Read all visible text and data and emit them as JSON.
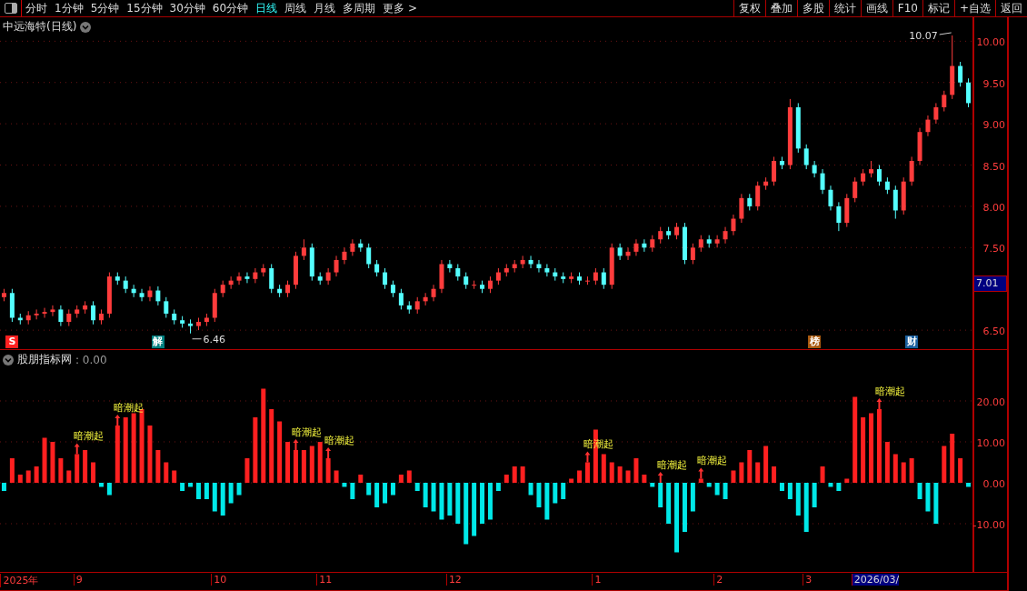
{
  "toolbar": {
    "tabs": [
      {
        "label": "分时",
        "selected": false
      },
      {
        "label": "1分钟",
        "selected": false
      },
      {
        "label": "5分钟",
        "selected": false
      },
      {
        "label": "15分钟",
        "selected": false
      },
      {
        "label": "30分钟",
        "selected": false
      },
      {
        "label": "60分钟",
        "selected": false
      },
      {
        "label": "日线",
        "selected": true
      },
      {
        "label": "周线",
        "selected": false
      },
      {
        "label": "月线",
        "selected": false
      },
      {
        "label": "多周期",
        "selected": false
      },
      {
        "label": "更多 >",
        "selected": false
      }
    ],
    "buttons": [
      "复权",
      "叠加",
      "多股",
      "统计",
      "画线",
      "F10",
      "标记",
      "+自选",
      "返回"
    ]
  },
  "main_chart": {
    "title": "中远海特(日线)",
    "chart_data": {
      "type": "candlestick",
      "ylim": [
        6.27,
        10.29
      ],
      "grid": true,
      "yticks": [
        {
          "value": 10,
          "label": "10.00"
        },
        {
          "value": 9.5,
          "label": "9.50"
        },
        {
          "value": 9,
          "label": "9.00"
        },
        {
          "value": 8.5,
          "label": "8.50"
        },
        {
          "value": 8,
          "label": "8.00"
        },
        {
          "value": 7.5,
          "label": "7.50"
        },
        {
          "value": 6.5,
          "label": "6.50"
        }
      ],
      "ohlc": [
        [
          6.9,
          7.0,
          6.85,
          6.95
        ],
        [
          6.95,
          7.0,
          6.6,
          6.65
        ],
        [
          6.65,
          6.7,
          6.57,
          6.62
        ],
        [
          6.62,
          6.73,
          6.57,
          6.68
        ],
        [
          6.68,
          6.75,
          6.63,
          6.7
        ],
        [
          6.7,
          6.77,
          6.65,
          6.72
        ],
        [
          6.72,
          6.8,
          6.67,
          6.75
        ],
        [
          6.75,
          6.8,
          6.55,
          6.6
        ],
        [
          6.6,
          6.75,
          6.55,
          6.7
        ],
        [
          6.7,
          6.8,
          6.65,
          6.75
        ],
        [
          6.75,
          6.85,
          6.7,
          6.8
        ],
        [
          6.8,
          6.85,
          6.57,
          6.62
        ],
        [
          6.62,
          6.75,
          6.57,
          6.7
        ],
        [
          6.7,
          7.2,
          6.65,
          7.15
        ],
        [
          7.15,
          7.2,
          7.05,
          7.1
        ],
        [
          7.1,
          7.15,
          6.95,
          7.0
        ],
        [
          7.0,
          7.05,
          6.9,
          6.95
        ],
        [
          6.95,
          7.0,
          6.85,
          6.9
        ],
        [
          6.9,
          7.03,
          6.85,
          6.98
        ],
        [
          6.98,
          7.03,
          6.8,
          6.85
        ],
        [
          6.85,
          6.9,
          6.65,
          6.7
        ],
        [
          6.7,
          6.75,
          6.57,
          6.62
        ],
        [
          6.62,
          6.67,
          6.53,
          6.58
        ],
        [
          6.58,
          6.63,
          6.46,
          6.55
        ],
        [
          6.55,
          6.65,
          6.5,
          6.6
        ],
        [
          6.6,
          6.7,
          6.55,
          6.65
        ],
        [
          6.65,
          7.0,
          6.6,
          6.95
        ],
        [
          6.95,
          7.1,
          6.9,
          7.05
        ],
        [
          7.05,
          7.15,
          7.0,
          7.1
        ],
        [
          7.1,
          7.2,
          7.05,
          7.15
        ],
        [
          7.15,
          7.2,
          7.07,
          7.12
        ],
        [
          7.12,
          7.25,
          7.07,
          7.2
        ],
        [
          7.2,
          7.3,
          7.15,
          7.25
        ],
        [
          7.25,
          7.3,
          6.95,
          7.0
        ],
        [
          7.0,
          7.05,
          6.9,
          6.95
        ],
        [
          6.95,
          7.1,
          6.9,
          7.05
        ],
        [
          7.05,
          7.45,
          7.0,
          7.4
        ],
        [
          7.4,
          7.6,
          7.35,
          7.5
        ],
        [
          7.5,
          7.55,
          7.1,
          7.15
        ],
        [
          7.15,
          7.2,
          7.05,
          7.1
        ],
        [
          7.1,
          7.25,
          7.05,
          7.2
        ],
        [
          7.2,
          7.4,
          7.15,
          7.35
        ],
        [
          7.35,
          7.5,
          7.3,
          7.45
        ],
        [
          7.45,
          7.6,
          7.4,
          7.55
        ],
        [
          7.55,
          7.6,
          7.45,
          7.5
        ],
        [
          7.5,
          7.55,
          7.25,
          7.3
        ],
        [
          7.3,
          7.35,
          7.15,
          7.2
        ],
        [
          7.2,
          7.25,
          7.0,
          7.05
        ],
        [
          7.05,
          7.1,
          6.9,
          6.95
        ],
        [
          6.95,
          7.0,
          6.75,
          6.8
        ],
        [
          6.8,
          6.85,
          6.7,
          6.75
        ],
        [
          6.75,
          6.9,
          6.7,
          6.85
        ],
        [
          6.85,
          6.95,
          6.8,
          6.9
        ],
        [
          6.9,
          7.05,
          6.85,
          7.0
        ],
        [
          7.0,
          7.35,
          6.95,
          7.3
        ],
        [
          7.3,
          7.35,
          7.2,
          7.25
        ],
        [
          7.25,
          7.3,
          7.1,
          7.15
        ],
        [
          7.15,
          7.2,
          7.0,
          7.05
        ],
        [
          7.05,
          7.1,
          7.0,
          7.05
        ],
        [
          7.05,
          7.1,
          6.95,
          7.0
        ],
        [
          7.0,
          7.15,
          6.95,
          7.1
        ],
        [
          7.1,
          7.25,
          7.05,
          7.2
        ],
        [
          7.2,
          7.3,
          7.15,
          7.25
        ],
        [
          7.25,
          7.35,
          7.2,
          7.3
        ],
        [
          7.3,
          7.4,
          7.25,
          7.35
        ],
        [
          7.35,
          7.4,
          7.25,
          7.3
        ],
        [
          7.3,
          7.35,
          7.2,
          7.25
        ],
        [
          7.25,
          7.3,
          7.15,
          7.2
        ],
        [
          7.2,
          7.25,
          7.1,
          7.15
        ],
        [
          7.15,
          7.2,
          7.07,
          7.12
        ],
        [
          7.12,
          7.2,
          7.07,
          7.15
        ],
        [
          7.15,
          7.2,
          7.05,
          7.1
        ],
        [
          7.1,
          7.15,
          7.05,
          7.1
        ],
        [
          7.1,
          7.25,
          7.05,
          7.2
        ],
        [
          7.2,
          7.25,
          7.0,
          7.05
        ],
        [
          7.05,
          7.55,
          7.0,
          7.5
        ],
        [
          7.5,
          7.55,
          7.35,
          7.4
        ],
        [
          7.4,
          7.5,
          7.35,
          7.45
        ],
        [
          7.45,
          7.6,
          7.4,
          7.55
        ],
        [
          7.55,
          7.6,
          7.45,
          7.5
        ],
        [
          7.5,
          7.65,
          7.45,
          7.6
        ],
        [
          7.6,
          7.75,
          7.55,
          7.7
        ],
        [
          7.7,
          7.75,
          7.6,
          7.65
        ],
        [
          7.65,
          7.8,
          7.6,
          7.75
        ],
        [
          7.75,
          7.8,
          7.3,
          7.35
        ],
        [
          7.35,
          7.55,
          7.3,
          7.5
        ],
        [
          7.5,
          7.65,
          7.45,
          7.6
        ],
        [
          7.6,
          7.65,
          7.5,
          7.55
        ],
        [
          7.55,
          7.65,
          7.5,
          7.6
        ],
        [
          7.6,
          7.75,
          7.55,
          7.7
        ],
        [
          7.7,
          7.9,
          7.65,
          7.85
        ],
        [
          7.85,
          8.15,
          7.8,
          8.1
        ],
        [
          8.1,
          8.15,
          7.95,
          8.0
        ],
        [
          8.0,
          8.3,
          7.95,
          8.25
        ],
        [
          8.25,
          8.35,
          8.2,
          8.3
        ],
        [
          8.3,
          8.6,
          8.25,
          8.55
        ],
        [
          8.55,
          8.6,
          8.45,
          8.5
        ],
        [
          8.5,
          9.3,
          8.45,
          9.2
        ],
        [
          9.2,
          9.25,
          8.65,
          8.7
        ],
        [
          8.7,
          8.75,
          8.45,
          8.5
        ],
        [
          8.5,
          8.55,
          8.35,
          8.4
        ],
        [
          8.4,
          8.45,
          8.15,
          8.2
        ],
        [
          8.2,
          8.25,
          7.95,
          8.0
        ],
        [
          8.0,
          8.05,
          7.7,
          7.8
        ],
        [
          7.8,
          8.15,
          7.75,
          8.1
        ],
        [
          8.1,
          8.35,
          8.05,
          8.3
        ],
        [
          8.3,
          8.45,
          8.25,
          8.4
        ],
        [
          8.4,
          8.55,
          8.35,
          8.45
        ],
        [
          8.45,
          8.5,
          8.25,
          8.3
        ],
        [
          8.3,
          8.35,
          8.15,
          8.2
        ],
        [
          8.2,
          8.25,
          7.85,
          7.95
        ],
        [
          7.95,
          8.35,
          7.9,
          8.3
        ],
        [
          8.3,
          8.6,
          8.25,
          8.55
        ],
        [
          8.55,
          8.95,
          8.5,
          8.9
        ],
        [
          8.9,
          9.1,
          8.85,
          9.05
        ],
        [
          9.05,
          9.25,
          9.0,
          9.2
        ],
        [
          9.2,
          9.4,
          9.15,
          9.35
        ],
        [
          9.35,
          10.07,
          9.3,
          9.7
        ],
        [
          9.7,
          9.75,
          9.45,
          9.5
        ],
        [
          9.5,
          9.55,
          9.2,
          9.25
        ]
      ],
      "annotations": [
        {
          "text": "10.07"
        },
        {
          "text": "6.46"
        }
      ]
    },
    "price_tag": "7.01",
    "markers": [
      {
        "label": "S",
        "color": "#ff2020"
      },
      {
        "label": "解",
        "color": "#008080"
      },
      {
        "label": "榜",
        "color": "#a85a10"
      },
      {
        "label": "财",
        "color": "#1a5f9e"
      }
    ]
  },
  "indicator": {
    "name": "股朋指标网",
    "value": ": 0.00",
    "chart_data": {
      "type": "bar",
      "ylim": [
        -21.78,
        32.44
      ],
      "grid": true,
      "yticks": [
        {
          "value": 20,
          "label": "20.00"
        },
        {
          "value": 10,
          "label": "10.00"
        },
        {
          "value": 0,
          "label": "0.00"
        },
        {
          "value": -10,
          "label": "-10.00"
        }
      ],
      "values": [
        -2,
        6,
        2,
        3,
        4,
        11,
        10,
        6,
        3,
        7,
        8,
        5,
        -1,
        -3,
        14,
        16,
        17,
        18,
        14,
        8,
        5,
        3,
        -2,
        -1,
        -4,
        -4,
        -7,
        -8,
        -5,
        -3,
        6,
        16,
        23,
        18,
        15,
        10,
        8,
        8,
        9,
        10,
        6,
        3,
        -1,
        -4,
        2,
        -3,
        -6,
        -5,
        -3,
        2,
        3,
        -2,
        -6,
        -7,
        -9,
        -8,
        -10,
        -15,
        -13,
        -10,
        -9,
        -2,
        2,
        4,
        4,
        -3,
        -6,
        -9,
        -5,
        -4,
        1,
        3,
        5,
        13,
        7,
        5,
        4,
        3,
        6,
        2,
        -1,
        -6,
        -10,
        -17,
        -12,
        -7,
        1,
        -1,
        -3,
        -4,
        3,
        5,
        8,
        5,
        9,
        4,
        -2,
        -4,
        -8,
        -12,
        -6,
        4,
        -1,
        -2,
        1,
        21,
        16,
        17,
        18,
        10,
        7,
        5,
        6,
        -4,
        -7,
        -10,
        9,
        12,
        6,
        -1
      ],
      "annotations": [
        {
          "text": "暗潮起"
        },
        {
          "text": "暗潮起"
        },
        {
          "text": "暗潮起"
        },
        {
          "text": "暗潮起"
        },
        {
          "text": "暗潮起"
        },
        {
          "text": "暗潮起"
        },
        {
          "text": "暗潮起"
        },
        {
          "text": "暗潮起"
        }
      ]
    }
  },
  "date_axis": [
    {
      "label": "2025年",
      "kind": "tick"
    },
    {
      "label": "9",
      "kind": "tick"
    },
    {
      "label": "10",
      "kind": "tick"
    },
    {
      "label": "11",
      "kind": "tick"
    },
    {
      "label": "12",
      "kind": "tick"
    },
    {
      "label": "1",
      "kind": "tick"
    },
    {
      "label": "2",
      "kind": "tick"
    },
    {
      "label": "3",
      "kind": "tick"
    },
    {
      "label": "2026/03/",
      "kind": "cursor"
    }
  ]
}
